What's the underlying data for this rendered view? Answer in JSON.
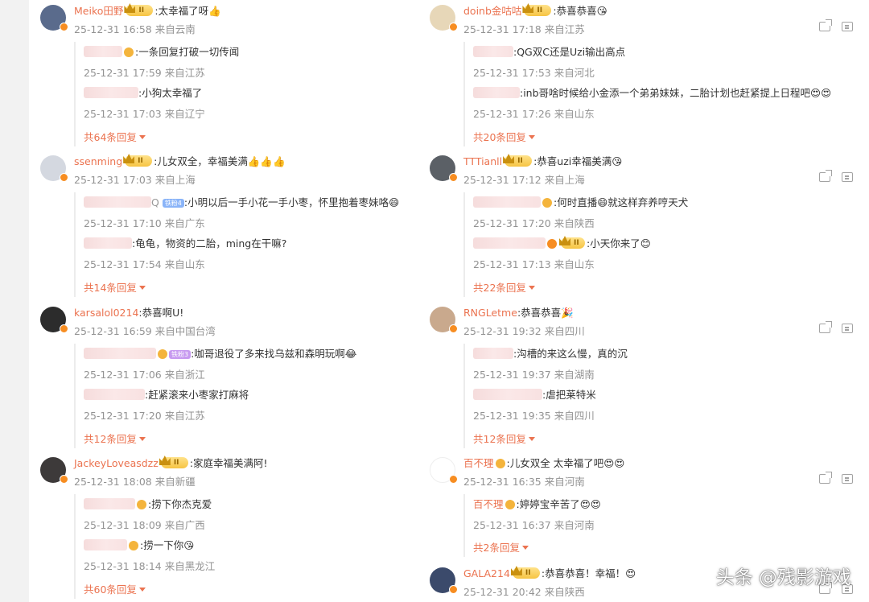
{
  "left": [
    {
      "user": "Meiko田野",
      "text": ":太幸福了呀👍",
      "meta": "25-12-31 16:58 来自云南",
      "avatar_color": "#5a6b8c",
      "replies": [
        {
          "text": ":一条回复打破一切传闻",
          "meta": "25-12-31 17:59 来自江苏",
          "blur": 48,
          "badge": true
        },
        {
          "text": ":小狗太幸福了",
          "meta": "25-12-31 17:03 来自辽宁",
          "blur": 68,
          "badge": false
        }
      ],
      "more": "共64条回复"
    },
    {
      "user": "ssenming",
      "text": ":儿女双全，幸福美满👍👍👍",
      "meta": "25-12-31 17:03 来自上海",
      "avatar_color": "#c9ced8",
      "replies": [
        {
          "text": ":小明以后一手小花一手小枣，怀里抱着枣妹咯😄",
          "meta": "25-12-31 17:10 来自广东",
          "blur": 92,
          "badge": false,
          "tag": "Q  ⊕铁粉4"
        },
        {
          "text": ":龟龟，物资的二胎，ming在干嘛?",
          "meta": "25-12-31 17:54 来自山东",
          "blur": 60,
          "badge": false
        }
      ],
      "more": "共14条回复"
    },
    {
      "user": "karsalol0214",
      "text": ":恭喜啊U!",
      "meta": "25-12-31 16:59 来自中国台湾",
      "avatar_color": "#2c2c2c",
      "replies": [
        {
          "text": ":咖哥退役了多来找乌兹和森明玩啊😂",
          "meta": "25-12-31 17:06 来自浙江",
          "blur": 90,
          "badge": true,
          "tag2": "铁粉3"
        },
        {
          "text": ":赶紧滚来小枣家打麻将",
          "meta": "25-12-31 17:20 来自江苏",
          "blur": 76,
          "badge": false
        }
      ],
      "more": "共12条回复"
    },
    {
      "user": "JackeyLoveasdzz",
      "text": ":家庭幸福美满阿!",
      "meta": "25-12-31 18:08 来自新疆",
      "avatar_color": "#3d3a3a",
      "replies": [
        {
          "text": ":捞下你杰克爱",
          "meta": "25-12-31 18:09 来自广西",
          "blur": 64,
          "badge": true
        },
        {
          "text": ":捞一下你😘",
          "meta": "25-12-31 18:14 来自黑龙江",
          "blur": 54,
          "badge": true
        }
      ],
      "more": "共60条回复"
    }
  ],
  "right": [
    {
      "user": "doinb金咕咕",
      "text": ":恭喜恭喜😘",
      "meta": "25-12-31 17:18 来自江苏",
      "avatar_color": "#e7d7b8",
      "replies": [
        {
          "text": ":QG双C还是Uzi输出高点",
          "meta": "25-12-31 17:53 来自河北",
          "blur": 50,
          "badge": false
        },
        {
          "text": ":inb哥啥时候给小金添一个弟弟妹妹，二胎计划也赶紧提上日程吧😍😍",
          "meta": "25-12-31 17:26 来自山东",
          "blur": 58,
          "badge": false
        }
      ],
      "more": "共20条回复"
    },
    {
      "user": "TTTianll",
      "text": ":恭喜uzi幸福美满😘",
      "meta": "25-12-31 17:12 来自上海",
      "avatar_color": "#5b6066",
      "replies": [
        {
          "text": ":何时直播😄就这样弃养哼天犬",
          "meta": "25-12-31 17:20 来自陕西",
          "blur": 84,
          "badge": true
        },
        {
          "text": ":小天你来了😊",
          "meta": "25-12-31 17:13 来自山东",
          "blur": 90,
          "badge": true,
          "crown": true
        }
      ],
      "more": "共22条回复"
    },
    {
      "user": "RNGLetme",
      "text": ":恭喜恭喜🎉",
      "meta": "25-12-31 19:32 来自四川",
      "avatar_color": "#c9a98d",
      "replies": [
        {
          "text": ":沟槽的来这么慢，真的沉",
          "meta": "25-12-31 19:37 来自湖南",
          "blur": 50,
          "badge": false
        },
        {
          "text": ":虐把莱特米",
          "meta": "25-12-31 19:35 来自四川",
          "blur": 86,
          "badge": false
        }
      ],
      "more": "共12条回复"
    },
    {
      "user": "百不理",
      "text": ":儿女双全 太幸福了吧😍😍",
      "meta": "25-12-31 16:35 来自河南",
      "avatar_color": "#ffffff",
      "replies": [
        {
          "text": ":婷婷宝辛苦了😍😍",
          "meta": "25-12-31 16:37 来自河南",
          "named": "百不理",
          "badge": true
        }
      ],
      "more": "共2条回复"
    },
    {
      "user": "GALA214",
      "text": ":恭喜恭喜！幸福！😍",
      "meta": "25-12-31 20:42 来自陕西",
      "avatar_color": "#3b4a6b",
      "replies": [],
      "more": ""
    }
  ],
  "watermark": "头条 @残影游戏",
  "colors": {
    "accent": "#eb7350",
    "meta": "#939393",
    "badge": "#f78d21"
  }
}
